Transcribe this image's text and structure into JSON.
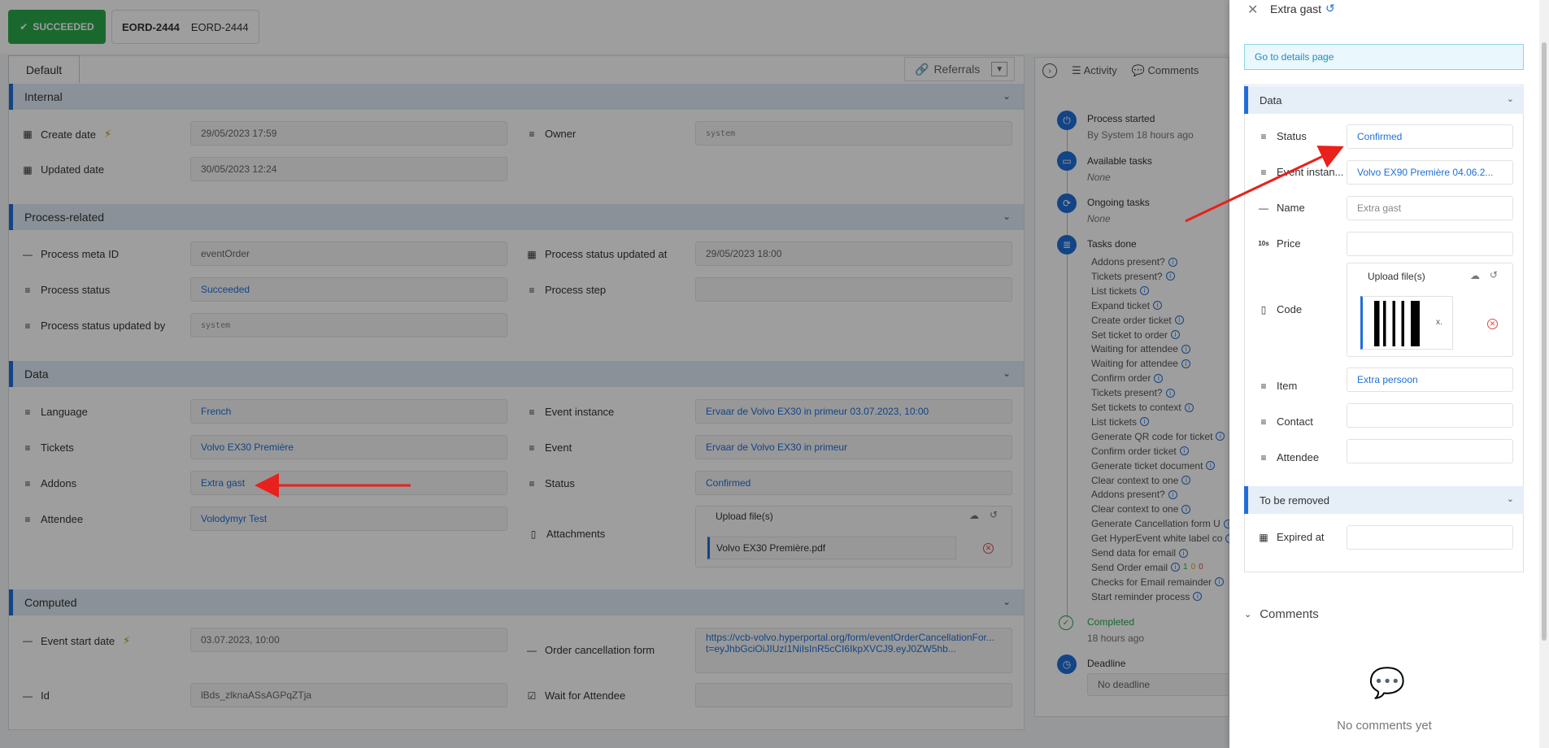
{
  "header": {
    "status_label": "SUCCEEDED",
    "order_id_bold": "EORD-2444",
    "order_id": "EORD-2444",
    "tab_default": "Default",
    "referrals_label": "Referrals"
  },
  "sections": {
    "internal": {
      "title": "Internal",
      "create_date_label": "Create date",
      "create_date_value": "29/05/2023 17:59",
      "updated_date_label": "Updated date",
      "updated_date_value": "30/05/2023 12:24",
      "owner_label": "Owner",
      "owner_value": "system"
    },
    "process": {
      "title": "Process-related",
      "meta_id_label": "Process meta ID",
      "meta_id_value": "eventOrder",
      "status_updated_at_label": "Process status updated at",
      "status_updated_at_value": "29/05/2023 18:00",
      "status_label": "Process status",
      "status_value": "Succeeded",
      "step_label": "Process step",
      "step_value": "",
      "status_updated_by_label": "Process status updated by",
      "status_updated_by_value": "system"
    },
    "data": {
      "title": "Data",
      "language_label": "Language",
      "language_value": "French",
      "event_instance_label": "Event instance",
      "event_instance_value": "Ervaar de Volvo EX30 in primeur 03.07.2023, 10:00",
      "tickets_label": "Tickets",
      "tickets_value": "Volvo EX30 Première",
      "event_label": "Event",
      "event_value": "Ervaar de Volvo EX30 in primeur",
      "addons_label": "Addons",
      "addons_value": "Extra gast",
      "status_label": "Status",
      "status_value": "Confirmed",
      "attendee_label": "Attendee",
      "attendee_value": "Volodymyr Test",
      "attachments_label": "Attachments",
      "upload_label": "Upload file(s)",
      "attachment_file": "Volvo EX30 Première.pdf"
    },
    "computed": {
      "title": "Computed",
      "event_start_label": "Event start date",
      "event_start_value": "03.07.2023, 10:00",
      "cancel_form_label": "Order cancellation form",
      "cancel_form_value": "https://vcb-volvo.hyperportal.org/form/eventOrderCancellationFor... t=eyJhbGciOiJIUzI1NiIsInR5cCI6IkpXVCJ9.eyJ0ZW5hb...",
      "id_label": "Id",
      "id_value": "lBds_zlknaASsAGPqZTja",
      "wait_label": "Wait for Attendee",
      "wait_value": ""
    }
  },
  "activity": {
    "tab_activity": "Activity",
    "tab_comments": "Comments",
    "process_started": "Process started",
    "process_started_sub": "By System 18 hours ago",
    "available_tasks": "Available tasks",
    "available_none": "None",
    "ongoing_tasks": "Ongoing tasks",
    "ongoing_none": "None",
    "tasks_done": "Tasks done",
    "tasks": [
      "Addons present?",
      "Tickets present?",
      "List tickets",
      "Expand ticket",
      "Create order ticket",
      "Set ticket to order",
      "Waiting for attendee",
      "Waiting for attendee",
      "Confirm order",
      "Tickets present?",
      "Set tickets to context",
      "List tickets",
      "Generate QR code for ticket",
      "Confirm order ticket",
      "Generate ticket document",
      "Clear context to one",
      "Addons present?",
      "Clear context to one",
      "Generate Cancellation form U",
      "Get HyperEvent white label co",
      "Send data for email",
      "Send Order email",
      "Checks for Email remainder",
      "Start reminder process"
    ],
    "send_order_counts": [
      "1",
      "0",
      "0"
    ],
    "completed": "Completed",
    "completed_sub": "18 hours ago",
    "deadline": "Deadline",
    "deadline_value": "No deadline"
  },
  "drawer": {
    "title": "Extra gast",
    "goto_label": "Go to details page",
    "data_title": "Data",
    "status_label": "Status",
    "status_value": "Confirmed",
    "event_instance_label": "Event instan...",
    "event_instance_value": "Volvo EX90 Première 04.06.2...",
    "name_label": "Name",
    "name_value": "Extra gast",
    "price_label": "Price",
    "price_prefix": "10s",
    "price_value": "",
    "code_label": "Code",
    "upload_label": "Upload file(s)",
    "code_file_suffix": "x.",
    "item_label": "Item",
    "item_value": "Extra persoon",
    "contact_label": "Contact",
    "contact_value": "",
    "attendee_label": "Attendee",
    "attendee_value": "",
    "removed_title": "To be removed",
    "expired_label": "Expired at",
    "expired_value": "",
    "comments_title": "Comments",
    "no_comments": "No comments yet"
  },
  "colors": {
    "accent": "#1e6fd9",
    "success": "#2aa84a",
    "danger": "#e04747",
    "annotation_arrow": "#e8211c"
  }
}
